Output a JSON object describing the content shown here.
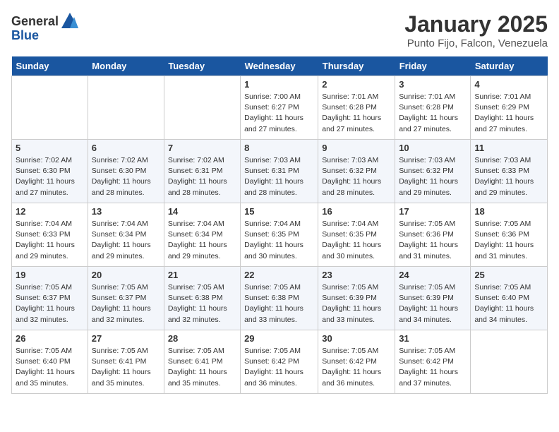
{
  "header": {
    "logo_general": "General",
    "logo_blue": "Blue",
    "month": "January 2025",
    "location": "Punto Fijo, Falcon, Venezuela"
  },
  "days_of_week": [
    "Sunday",
    "Monday",
    "Tuesday",
    "Wednesday",
    "Thursday",
    "Friday",
    "Saturday"
  ],
  "weeks": [
    [
      {
        "day": "",
        "info": ""
      },
      {
        "day": "",
        "info": ""
      },
      {
        "day": "",
        "info": ""
      },
      {
        "day": "1",
        "info": "Sunrise: 7:00 AM\nSunset: 6:27 PM\nDaylight: 11 hours and 27 minutes."
      },
      {
        "day": "2",
        "info": "Sunrise: 7:01 AM\nSunset: 6:28 PM\nDaylight: 11 hours and 27 minutes."
      },
      {
        "day": "3",
        "info": "Sunrise: 7:01 AM\nSunset: 6:28 PM\nDaylight: 11 hours and 27 minutes."
      },
      {
        "day": "4",
        "info": "Sunrise: 7:01 AM\nSunset: 6:29 PM\nDaylight: 11 hours and 27 minutes."
      }
    ],
    [
      {
        "day": "5",
        "info": "Sunrise: 7:02 AM\nSunset: 6:30 PM\nDaylight: 11 hours and 27 minutes."
      },
      {
        "day": "6",
        "info": "Sunrise: 7:02 AM\nSunset: 6:30 PM\nDaylight: 11 hours and 28 minutes."
      },
      {
        "day": "7",
        "info": "Sunrise: 7:02 AM\nSunset: 6:31 PM\nDaylight: 11 hours and 28 minutes."
      },
      {
        "day": "8",
        "info": "Sunrise: 7:03 AM\nSunset: 6:31 PM\nDaylight: 11 hours and 28 minutes."
      },
      {
        "day": "9",
        "info": "Sunrise: 7:03 AM\nSunset: 6:32 PM\nDaylight: 11 hours and 28 minutes."
      },
      {
        "day": "10",
        "info": "Sunrise: 7:03 AM\nSunset: 6:32 PM\nDaylight: 11 hours and 29 minutes."
      },
      {
        "day": "11",
        "info": "Sunrise: 7:03 AM\nSunset: 6:33 PM\nDaylight: 11 hours and 29 minutes."
      }
    ],
    [
      {
        "day": "12",
        "info": "Sunrise: 7:04 AM\nSunset: 6:33 PM\nDaylight: 11 hours and 29 minutes."
      },
      {
        "day": "13",
        "info": "Sunrise: 7:04 AM\nSunset: 6:34 PM\nDaylight: 11 hours and 29 minutes."
      },
      {
        "day": "14",
        "info": "Sunrise: 7:04 AM\nSunset: 6:34 PM\nDaylight: 11 hours and 29 minutes."
      },
      {
        "day": "15",
        "info": "Sunrise: 7:04 AM\nSunset: 6:35 PM\nDaylight: 11 hours and 30 minutes."
      },
      {
        "day": "16",
        "info": "Sunrise: 7:04 AM\nSunset: 6:35 PM\nDaylight: 11 hours and 30 minutes."
      },
      {
        "day": "17",
        "info": "Sunrise: 7:05 AM\nSunset: 6:36 PM\nDaylight: 11 hours and 31 minutes."
      },
      {
        "day": "18",
        "info": "Sunrise: 7:05 AM\nSunset: 6:36 PM\nDaylight: 11 hours and 31 minutes."
      }
    ],
    [
      {
        "day": "19",
        "info": "Sunrise: 7:05 AM\nSunset: 6:37 PM\nDaylight: 11 hours and 32 minutes."
      },
      {
        "day": "20",
        "info": "Sunrise: 7:05 AM\nSunset: 6:37 PM\nDaylight: 11 hours and 32 minutes."
      },
      {
        "day": "21",
        "info": "Sunrise: 7:05 AM\nSunset: 6:38 PM\nDaylight: 11 hours and 32 minutes."
      },
      {
        "day": "22",
        "info": "Sunrise: 7:05 AM\nSunset: 6:38 PM\nDaylight: 11 hours and 33 minutes."
      },
      {
        "day": "23",
        "info": "Sunrise: 7:05 AM\nSunset: 6:39 PM\nDaylight: 11 hours and 33 minutes."
      },
      {
        "day": "24",
        "info": "Sunrise: 7:05 AM\nSunset: 6:39 PM\nDaylight: 11 hours and 34 minutes."
      },
      {
        "day": "25",
        "info": "Sunrise: 7:05 AM\nSunset: 6:40 PM\nDaylight: 11 hours and 34 minutes."
      }
    ],
    [
      {
        "day": "26",
        "info": "Sunrise: 7:05 AM\nSunset: 6:40 PM\nDaylight: 11 hours and 35 minutes."
      },
      {
        "day": "27",
        "info": "Sunrise: 7:05 AM\nSunset: 6:41 PM\nDaylight: 11 hours and 35 minutes."
      },
      {
        "day": "28",
        "info": "Sunrise: 7:05 AM\nSunset: 6:41 PM\nDaylight: 11 hours and 35 minutes."
      },
      {
        "day": "29",
        "info": "Sunrise: 7:05 AM\nSunset: 6:42 PM\nDaylight: 11 hours and 36 minutes."
      },
      {
        "day": "30",
        "info": "Sunrise: 7:05 AM\nSunset: 6:42 PM\nDaylight: 11 hours and 36 minutes."
      },
      {
        "day": "31",
        "info": "Sunrise: 7:05 AM\nSunset: 6:42 PM\nDaylight: 11 hours and 37 minutes."
      },
      {
        "day": "",
        "info": ""
      }
    ]
  ]
}
